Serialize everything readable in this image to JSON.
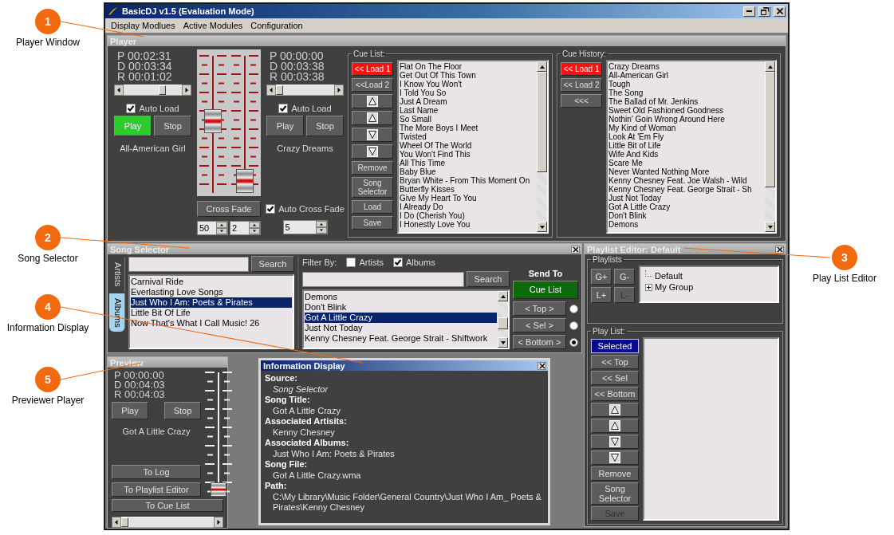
{
  "annotations": [
    {
      "number": "1",
      "label": "Player Window"
    },
    {
      "number": "2",
      "label": "Song Selector"
    },
    {
      "number": "4",
      "label": "Information Display"
    },
    {
      "number": "5",
      "label": "Previewer Player"
    },
    {
      "number": "3",
      "label": "Play List Editor"
    }
  ],
  "window": {
    "title": "BasicDJ v1.5 (Evaluation Mode)"
  },
  "menu": [
    "Display Modlues",
    "Active Modules",
    "Configuration"
  ],
  "player": {
    "title": "Player",
    "focused": false,
    "decks": [
      {
        "times": [
          "P 00:02:31",
          "D 00:03:34",
          "R 00:01:02"
        ],
        "position": {
          "level": 0.68
        },
        "auto_load": {
          "label": "Auto Load",
          "checked": true
        },
        "play": {
          "label": "Play",
          "active": true
        },
        "stop": {
          "label": "Stop"
        },
        "song": "All-American Girl"
      },
      {
        "times": [
          "P 00:00:00",
          "D 00:03:38",
          "R 00:03:38"
        ],
        "position": {
          "level": 0.0
        },
        "auto_load": {
          "label": "Auto Load",
          "checked": true
        },
        "play": {
          "label": "Play",
          "active": false
        },
        "stop": {
          "label": "Stop"
        },
        "song": "Crazy Dreams"
      }
    ],
    "mixer": {
      "faders": [
        {
          "level": 0.53
        },
        {
          "level": 0.0
        }
      ],
      "cross_fade": "Cross Fade",
      "spinners": [
        "50",
        "2"
      ],
      "auto_cross_fade": {
        "label": "Auto Cross Fade",
        "checked": true
      },
      "fade_spinner": "5"
    },
    "cue_list": {
      "title": "Cue List:",
      "buttons": [
        {
          "kind": "text",
          "label": "<< Load 1",
          "active": true
        },
        {
          "kind": "text",
          "label": "<<Load 2",
          "active": false
        },
        {
          "kind": "up",
          "active": false
        },
        {
          "kind": "up",
          "active": false
        },
        {
          "kind": "down",
          "active": false
        },
        {
          "kind": "down",
          "active": false
        },
        {
          "kind": "text",
          "label": "Remove",
          "active": false
        },
        {
          "kind": "text",
          "label": "Song Selector",
          "active": false
        },
        {
          "kind": "text",
          "label": "Load",
          "active": false
        },
        {
          "kind": "text",
          "label": "Save",
          "active": false
        }
      ],
      "items": [
        "Flat On The Floor",
        "Get Out Of This Town",
        "I Know You Won't",
        "I Told You So",
        "Just A Dream",
        "Last Name",
        "So Small",
        "The More Boys I Meet",
        "Twisted",
        "Wheel Of The World",
        "You Won't Find This",
        "All This Time",
        "Baby Blue",
        "Bryan White - From This Moment On",
        "Butterfly Kisses",
        "Give My Heart To You",
        "I Already Do",
        "I Do (Cherish You)",
        "I Honestly Love You"
      ]
    },
    "cue_history": {
      "title": "Cue History:",
      "buttons": [
        {
          "label": "<< Load 1",
          "active": true
        },
        {
          "label": "<< Load 2",
          "active": false
        },
        {
          "label": "<<<",
          "active": false
        }
      ],
      "items": [
        "Crazy Dreams",
        "All-American Girl",
        "Tough",
        "The Song",
        "The Ballad of Mr. Jenkins",
        "Sweet Old Fashioned Goodness",
        "Nothin' Goin Wrong Around Here",
        "My Kind of Woman",
        "Look At 'Em Fly",
        "Little Bit of Life",
        "Wife And Kids",
        "Scare Me",
        "Never Wanted Nothing More",
        "Kenny Chesney Feat. Joe Walsh - Wild",
        "Kenny Chesney Feat. George Strait - Sh",
        "Just Not Today",
        "Got A Little Crazy",
        "Don't Blink",
        "Demons"
      ]
    }
  },
  "song_selector": {
    "title": "Song Selector",
    "focused": false,
    "tabs": [
      {
        "label": "Artists",
        "selected": false
      },
      {
        "label": "Albums",
        "selected": true
      }
    ],
    "album_search": {
      "button": "Search"
    },
    "albums": [
      {
        "label": "Carnival Ride",
        "selected": false
      },
      {
        "label": "Everlasting Love Songs",
        "selected": false
      },
      {
        "label": "Just Who I Am: Poets & Pirates",
        "selected": true
      },
      {
        "label": "Little Bit Of Life",
        "selected": false
      },
      {
        "label": "Now That's What I Call Music! 26",
        "selected": false
      }
    ],
    "filter": {
      "label": "Filter By:",
      "options": [
        {
          "label": "Artists",
          "checked": false
        },
        {
          "label": "Albums",
          "checked": true
        }
      ]
    },
    "song_search": {
      "button": "Search"
    },
    "songs": [
      {
        "label": "Demons",
        "selected": false
      },
      {
        "label": "Don't Blink",
        "selected": false
      },
      {
        "label": "Got A Little Crazy",
        "selected": true
      },
      {
        "label": "Just Not Today",
        "selected": false
      },
      {
        "label": "Kenny Chesney Feat. George Strait - Shiftwork",
        "selected": false
      }
    ],
    "send_to": {
      "label": "Send To",
      "target": {
        "label": "Cue List",
        "active": true
      },
      "positions": [
        {
          "label": "< Top >",
          "selected": false
        },
        {
          "label": "< Sel >",
          "selected": false
        },
        {
          "label": "< Bottom >",
          "selected": true
        }
      ]
    }
  },
  "preview": {
    "title": "Preview",
    "focused": false,
    "times": [
      "P 00:00:00",
      "D 00:04:03",
      "R 00:04:03"
    ],
    "play": {
      "label": "Play"
    },
    "stop": {
      "label": "Stop"
    },
    "song": "Got A Little Crazy",
    "buttons": [
      "To Log",
      "To Playlist Editor",
      "To Cue List"
    ],
    "fader": {
      "level": 0.0
    },
    "position": {
      "level": 0.0
    }
  },
  "info_display": {
    "title": "Information Display",
    "focused": true,
    "fields": [
      {
        "label": "Source:",
        "value": "Song Selector",
        "italic": true
      },
      {
        "label": "Song Title:",
        "value": "Got A Little Crazy",
        "italic": false
      },
      {
        "label": "Associated Artisits:",
        "value": "Kenny Chesney",
        "italic": false
      },
      {
        "label": "Associated Albums:",
        "value": "Just Who I Am: Poets & Pirates",
        "italic": false
      },
      {
        "label": "Song File:",
        "value": "Got A Little Crazy.wma",
        "italic": false
      },
      {
        "label": "Path:",
        "value": "C:\\My Library\\Music Folder\\General Country\\Just Who I Am_ Poets & Pirates\\Kenny Chesney",
        "italic": false
      }
    ]
  },
  "playlist_editor": {
    "title": "Playlist Editor: Default",
    "focused": false,
    "playlists": {
      "title": "Playlists",
      "buttons": [
        {
          "label": "G+",
          "disabled": false
        },
        {
          "label": "G-",
          "disabled": false
        },
        {
          "label": "L+",
          "disabled": false
        },
        {
          "label": "L-",
          "disabled": true
        }
      ],
      "tree": [
        {
          "label": "Default"
        },
        {
          "label": "My Group",
          "expanded": false
        }
      ]
    },
    "play_list": {
      "title": "Play List:",
      "buttons": [
        {
          "kind": "text",
          "label": "Selected",
          "active": true,
          "disabled": false
        },
        {
          "kind": "text",
          "label": "<< Top",
          "active": false,
          "disabled": false
        },
        {
          "kind": "text",
          "label": "<< Sel",
          "active": false,
          "disabled": false
        },
        {
          "kind": "text",
          "label": "<< Bottom",
          "active": false,
          "disabled": false
        },
        {
          "kind": "up",
          "active": false,
          "disabled": false
        },
        {
          "kind": "up",
          "active": false,
          "disabled": false
        },
        {
          "kind": "down",
          "active": false,
          "disabled": false
        },
        {
          "kind": "down",
          "active": false,
          "disabled": false
        },
        {
          "kind": "text",
          "label": "Remove",
          "active": false,
          "disabled": false
        },
        {
          "kind": "text",
          "label": "Song Selector",
          "active": false,
          "disabled": false
        },
        {
          "kind": "text",
          "label": "Save",
          "active": false,
          "disabled": true
        }
      ]
    }
  }
}
